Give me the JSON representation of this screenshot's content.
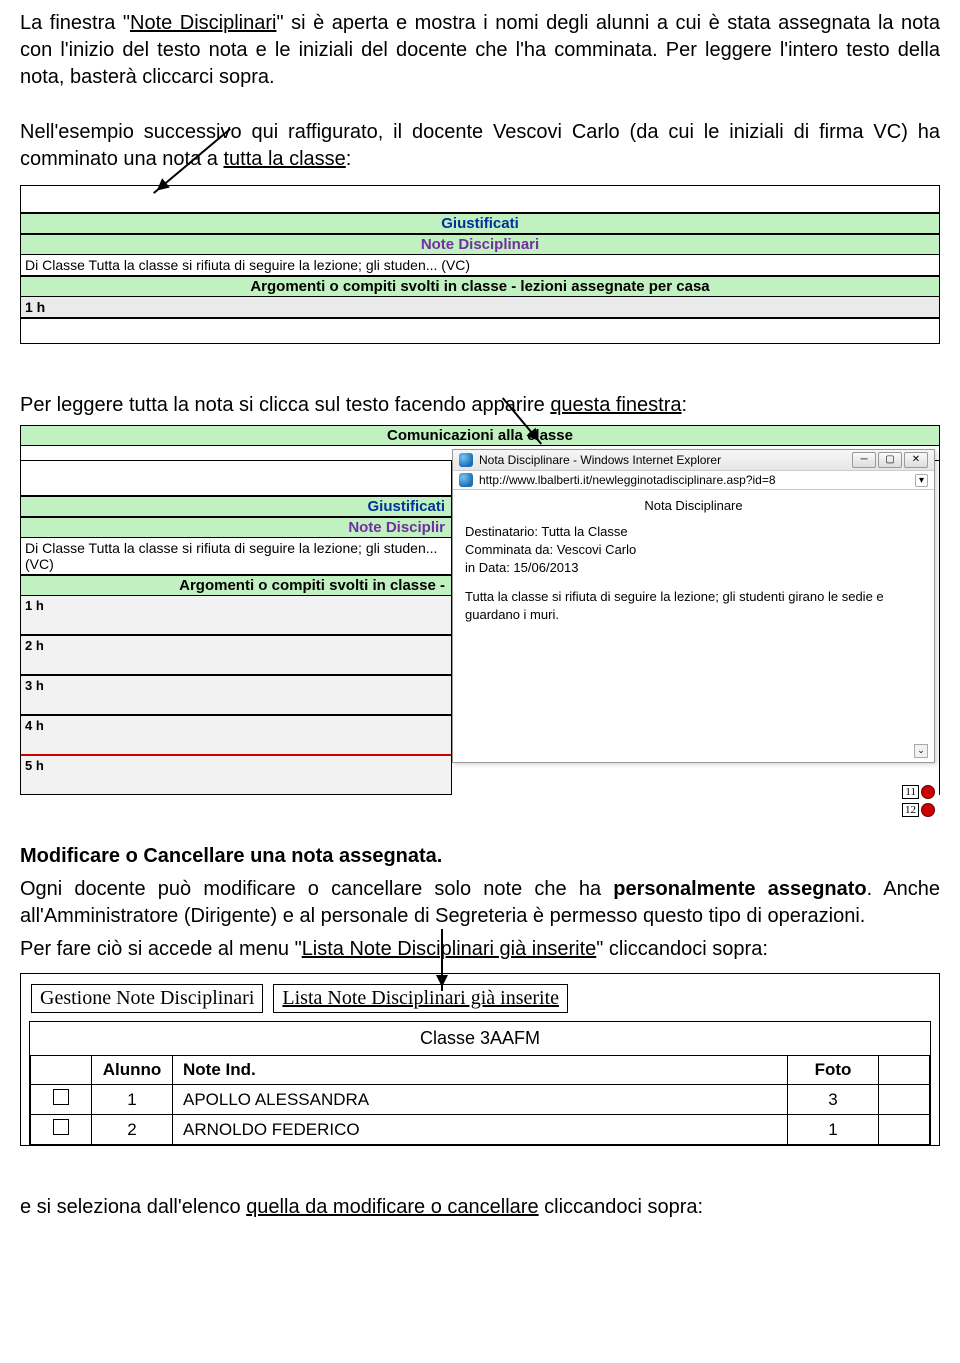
{
  "para1_a": "La finestra \"",
  "para1_b": "Note Disciplinari",
  "para1_c": "\" si è aperta e mostra i nomi degli alunni a cui è stata assegnata la nota con l'inizio del testo nota e le iniziali del docente che l'ha comminata. Per leggere l'intero testo della nota, basterà cliccarci sopra.",
  "para2_a": "Nell'esempio successivo qui raffigurato,  il docente Vescovi Carlo (da cui le iniziali di firma VC) ha comminato una nota a ",
  "para2_b": "tutta la classe",
  "para2_c": ":",
  "shot1": {
    "giustificati": "Giustificati",
    "noteDisc": "Note Disciplinari",
    "noteRow": "Di Classe Tutta la classe si rifiuta di seguire la lezione; gli studen... (VC)",
    "argomenti": "Argomenti o compiti svolti in classe - lezioni assegnate per casa",
    "h1": "1 h"
  },
  "para3_a": "Per leggere tutta la nota si clicca sul testo facendo apparire ",
  "para3_b": "questa finestra",
  "para3_c": ":",
  "shot2": {
    "comunicazioni": "Comunicazioni alla classe",
    "left": {
      "giustificati": "Giustificati",
      "noteDisc": "Note Disciplir",
      "noteRow": "Di Classe Tutta la classe si rifiuta di seguire la lezione; gli studen... (VC)",
      "argomenti": "Argomenti o compiti svolti in classe -",
      "hours": [
        "1 h",
        "2 h",
        "3 h",
        "4 h",
        "5 h"
      ]
    },
    "popup": {
      "title": "Nota Disciplinare - Windows Internet Explorer",
      "url": "http://www.lbalberti.it/newlegginotadisciplinare.asp?id=8",
      "heading": "Nota Disciplinare",
      "l1a": "Destinatario: ",
      "l1b": "Tutta la Classe",
      "l2a": "Comminata da: ",
      "l2b": "Vescovi Carlo",
      "l3a": "in Data: ",
      "l3b": "15/06/2013",
      "body": "Tutta la classe si rifiuta di seguire la lezione; gli studenti girano le sedie e guardano i muri."
    },
    "mini": {
      "n1": "11",
      "n2": "12"
    }
  },
  "heading2": "Modificare o Cancellare una nota assegnata.",
  "para4_a": "Ogni docente può modificare o cancellare solo note che ha ",
  "para4_b": "personalmente assegnato",
  "para4_c": ". Anche all'Amministratore (Dirigente) e al  personale di Segreteria è permesso questo tipo di operazioni.",
  "para5_a": "Per fare ciò si accede al menu \"",
  "para5_b": "Lista Note Disciplinari già inserite",
  "para5_c": "\" cliccandoci sopra:",
  "shot3": {
    "tab1": "Gestione Note Disciplinari",
    "tab2": "Lista Note Disciplinari già inserite",
    "classe": "Classe 3AAFM",
    "cols": {
      "alunno": "Alunno",
      "noteind": "Note Ind.",
      "foto": "Foto"
    },
    "rows": [
      {
        "idx": "1",
        "name": "APOLLO ALESSANDRA",
        "foto": "3"
      },
      {
        "idx": "2",
        "name": "ARNOLDO FEDERICO",
        "foto": "1"
      }
    ]
  },
  "para6_a": "e si seleziona dall'elenco ",
  "para6_b": "quella da modificare o cancellare",
  "para6_c": " cliccandoci sopra:"
}
